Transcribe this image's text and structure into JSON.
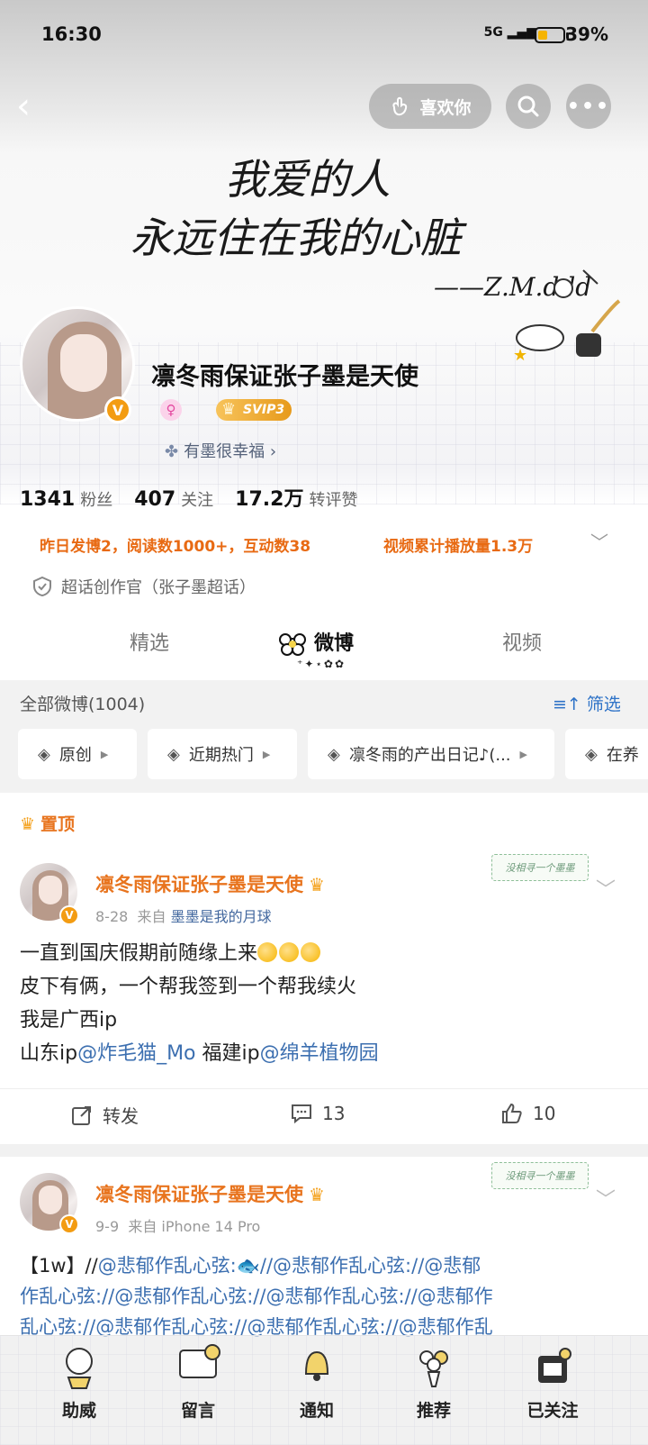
{
  "status_bar": {
    "time": "16:30",
    "signal": "5G",
    "battery_pct": "39%",
    "battery_level": 0.39
  },
  "header": {
    "like_label": "喜欢你"
  },
  "cover_text": {
    "line1": "我爱的人",
    "line2": "永远住在我的心脏",
    "signature": "——Z.M.ddd"
  },
  "profile": {
    "name": "凛冬雨保证张子墨是天使",
    "verified_mark": "V",
    "gender_mark": "♀",
    "vip_label": "SVIP3",
    "fan_group": "有墨很幸福 ›",
    "stats": [
      {
        "value": "1341",
        "label": "粉丝"
      },
      {
        "value": "407",
        "label": "关注"
      },
      {
        "value": "17.2万",
        "label": "转评赞"
      }
    ],
    "brief_left": "昨日发博2，阅读数1000+，互动数38",
    "brief_right": "视频累计播放量1.3万",
    "title": "超话创作官（张子墨超话）"
  },
  "tabs": [
    {
      "label": "精选"
    },
    {
      "label": "微博",
      "active": true
    },
    {
      "label": "视频"
    }
  ],
  "filter": {
    "all_label": "全部微博(1004)",
    "sift_label": "筛选",
    "chips": [
      "原创",
      "近期热门",
      "凛冬雨的产出日记♪(...",
      "在养"
    ]
  },
  "posts": [
    {
      "pinned_label": "置顶",
      "author": "凛冬雨保证张子墨是天使",
      "date": "8-28",
      "from_prefix": "来自",
      "source": "墨墨是我的月球",
      "stamp": "没相寻一个墨墨",
      "lines": [
        "一直到国庆假期前随缘上来",
        "皮下有俩，一个帮我签到一个帮我续火",
        "我是广西ip"
      ],
      "line4": {
        "a": "山东ip",
        "b": "@炸毛猫_Mo",
        "c": " 福建ip",
        "d": "@绵羊植物园"
      },
      "actions": {
        "repost": "转发",
        "comments": "13",
        "likes": "10"
      }
    },
    {
      "author": "凛冬雨保证张子墨是天使",
      "date": "9-9",
      "from_prefix": "来自",
      "source": "iPhone 14 Pro",
      "stamp": "没相寻一个墨墨",
      "text_prefix": "【1w】//",
      "text_line1": "@悲郁作乱心弦:🐟//@悲郁作乱心弦://@悲郁",
      "text_line2": "作乱心弦://@悲郁作乱心弦://@悲郁作乱心弦://@悲郁作",
      "text_line3": "乱心弦://@悲郁作乱心弦://@悲郁作乱心弦://@悲郁作乱"
    }
  ],
  "bottom_nav": [
    {
      "label": "助威"
    },
    {
      "label": "留言"
    },
    {
      "label": "通知"
    },
    {
      "label": "推荐"
    },
    {
      "label": "已关注"
    }
  ],
  "colors": {
    "accent_orange": "#e8741e",
    "link_blue": "#3c6fb0",
    "brief_orange": "#e86a13",
    "badge_orange": "#f39c12"
  }
}
